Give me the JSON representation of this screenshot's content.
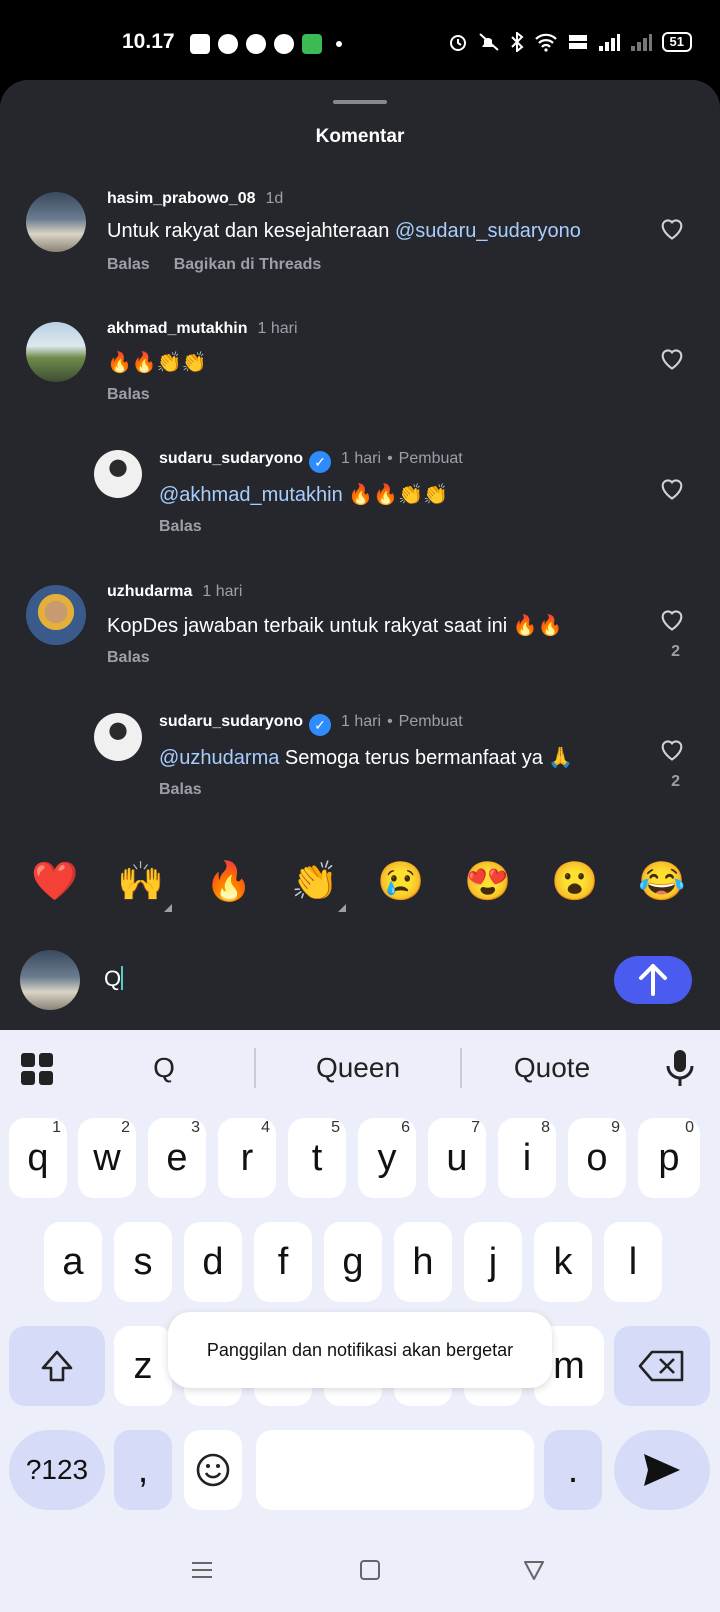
{
  "status_bar": {
    "time": "10.17",
    "battery": "51"
  },
  "sheet": {
    "title": "Komentar"
  },
  "comments": [
    {
      "user": "hasim_prabowo_08",
      "time": "1d",
      "text_plain": "Untuk rakyat dan kesejahteraan ",
      "mention": "@sudaru_sudaryono",
      "actions": [
        "Balas",
        "Bagikan di Threads"
      ],
      "likes": ""
    },
    {
      "user": "akhmad_mutakhin",
      "time": "1 hari",
      "text_plain": "🔥🔥👏👏",
      "actions": [
        "Balas"
      ],
      "likes": ""
    },
    {
      "user": "sudaru_sudaryono",
      "time": "1 hari",
      "creator": "Pembuat",
      "mention": "@akhmad_mutakhin",
      "text_plain": " 🔥🔥👏👏",
      "actions": [
        "Balas"
      ],
      "likes": ""
    },
    {
      "user": "uzhudarma",
      "time": "1 hari",
      "text_plain": "KopDes jawaban terbaik untuk rakyat saat ini 🔥🔥",
      "actions": [
        "Balas"
      ],
      "likes": "2"
    },
    {
      "user": "sudaru_sudaryono",
      "time": "1 hari",
      "creator": "Pembuat",
      "mention": "@uzhudarma",
      "text_plain": " Semoga terus bermanfaat ya 🙏",
      "actions": [
        "Balas"
      ],
      "likes": "2"
    }
  ],
  "emoji_bar": [
    "❤️",
    "🙌",
    "🔥",
    "👏",
    "😢",
    "😍",
    "😮",
    "😂"
  ],
  "input": {
    "value": "Q"
  },
  "keyboard": {
    "suggestions": [
      "Q",
      "Queen",
      "Quote"
    ],
    "row1": [
      "q",
      "w",
      "e",
      "r",
      "t",
      "y",
      "u",
      "i",
      "o",
      "p"
    ],
    "row1_nums": [
      "1",
      "2",
      "3",
      "4",
      "5",
      "6",
      "7",
      "8",
      "9",
      "0"
    ],
    "row2": [
      "a",
      "s",
      "d",
      "f",
      "g",
      "h",
      "j",
      "k",
      "l"
    ],
    "row3_visible": [
      "z",
      "m"
    ],
    "symbols_key": "?123",
    "comma": ",",
    "period": "."
  },
  "toast": "Panggilan dan notifikasi akan bergetar",
  "colors": {
    "sheet_bg": "#25272c",
    "mention": "#a8cdff",
    "send_button": "#4a5cf0",
    "verified": "#2f8cff",
    "keyboard_bg": "#eceffa"
  }
}
